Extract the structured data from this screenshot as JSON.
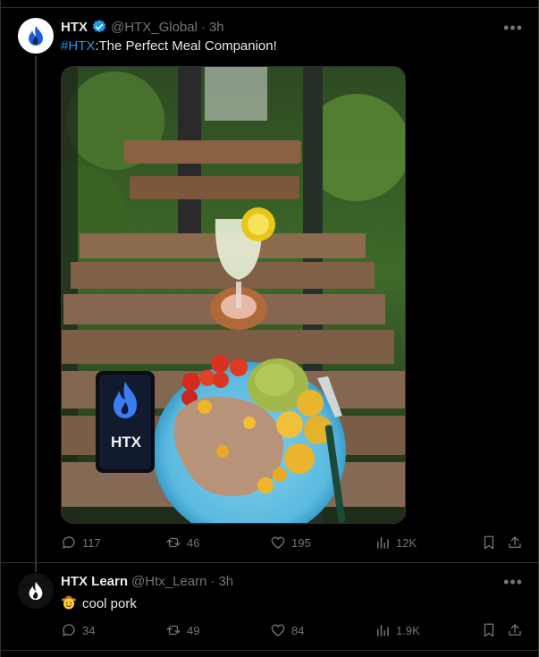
{
  "tweet1": {
    "display_name": "HTX",
    "handle": "@HTX_Global",
    "separator": "·",
    "time": "3h",
    "hashtag": "#HTX",
    "text": ":The Perfect Meal Companion!",
    "more_icon": "more-horizontal-icon",
    "phone_logo_text": "HTX",
    "stats": {
      "replies": "117",
      "reposts": "46",
      "likes": "195",
      "views": "12K"
    }
  },
  "tweet2": {
    "display_name": "HTX Learn",
    "handle": "@Htx_Learn",
    "separator": "·",
    "time": "3h",
    "text": "cool pork",
    "emoji": "smiling-face-with-cowboy-hat-icon",
    "stats": {
      "replies": "34",
      "reposts": "49",
      "likes": "84",
      "views": "1.9K"
    }
  },
  "colors": {
    "background": "#000000",
    "text": "#e7e9ea",
    "muted": "#71767b",
    "accent": "#1d9bf0",
    "border": "#2f3336"
  }
}
